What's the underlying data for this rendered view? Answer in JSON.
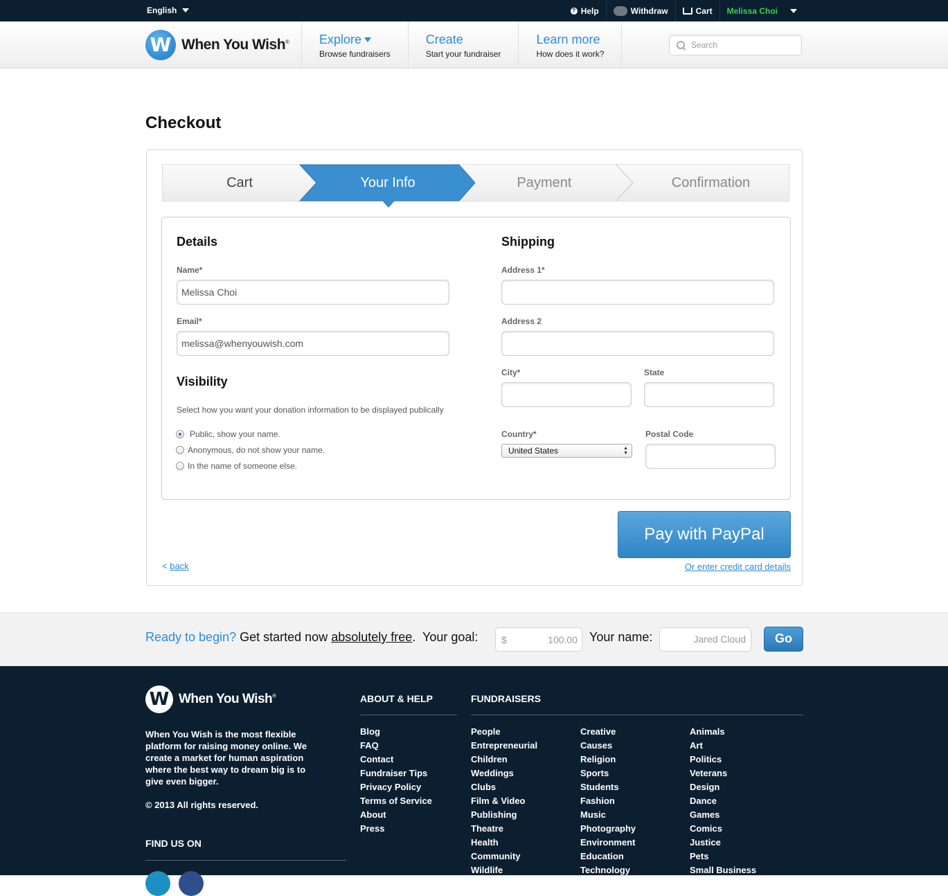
{
  "topbar": {
    "language": "English",
    "help": "Help",
    "withdraw": "Withdraw",
    "cart": "Cart",
    "user": "Melissa Choi",
    "icons": [
      "help-icon",
      "piggy-bank-icon",
      "cart-icon"
    ]
  },
  "header": {
    "logo_text": "When You Wish",
    "logo_mark": "W",
    "logo_reg": "®",
    "nav": [
      {
        "title": "Explore",
        "sub": "Browse fundraisers"
      },
      {
        "title": "Create",
        "sub": "Start your fundraiser"
      },
      {
        "title": "Learn more",
        "sub": "How does it work?"
      }
    ],
    "search_placeholder": "Search"
  },
  "page": {
    "title": "Checkout"
  },
  "steps": [
    {
      "label": "Cart",
      "state": "done"
    },
    {
      "label": "Your Info",
      "state": "active"
    },
    {
      "label": "Payment",
      "state": "pending"
    },
    {
      "label": "Confirmation",
      "state": "pending"
    }
  ],
  "details": {
    "heading": "Details",
    "name_label": "Name*",
    "name_value": "Melissa Choi",
    "email_label": "Email*",
    "email_value": "melissa@whenyouwish.com"
  },
  "visibility": {
    "heading": "Visibility",
    "description": "Select how you want your donation information to be displayed publically",
    "options": [
      {
        "label": "Public, show your name.",
        "selected": true
      },
      {
        "label": "Anonymous, do not show your name.",
        "selected": false
      },
      {
        "label": "In the name of someone else.",
        "selected": false
      }
    ]
  },
  "shipping": {
    "heading": "Shipping",
    "address1_label": "Address 1*",
    "address2_label": "Address 2",
    "city_label": "City*",
    "state_label": "State",
    "country_label": "Country*",
    "country_value": "United States",
    "postal_label": "Postal Code"
  },
  "actions": {
    "paypal": "Pay with PayPal",
    "back_prefix": "<",
    "back": "back",
    "credit_card": "Or enter credit card details"
  },
  "ready": {
    "lead": "Ready to begin?",
    "text1": "Get started now",
    "free": "absolutely free",
    "text2": ".  Your goal:",
    "currency": "$",
    "goal_value": "100.00",
    "name_label": "Your name:",
    "name_placeholder": "Jared Cloud",
    "go": "Go"
  },
  "footer": {
    "logo_text": "When You Wish",
    "logo_mark": "W",
    "logo_reg": "®",
    "about": "When You Wish is the most flexible platform for raising money online. We create a market for human aspiration where the best way to dream big is to give even bigger.",
    "copyright": "© 2013 All rights reserved.",
    "find_us": "FIND US ON",
    "about_help_heading": "ABOUT & HELP",
    "about_help_links": [
      "Blog",
      "FAQ",
      "Contact",
      "Fundraiser Tips",
      "Privacy Policy",
      "Terms of Service",
      "About",
      "Press"
    ],
    "fundraisers_heading": "FUNDRAISERS",
    "col1": [
      "People",
      "Entrepreneurial",
      "Children",
      "Weddings",
      "Clubs",
      "Film & Video",
      "Publishing",
      "Theatre",
      "Health",
      "Community",
      "Wildlife"
    ],
    "col2": [
      "Creative",
      "Causes",
      "Religion",
      "Sports",
      "Students",
      "Fashion",
      "Music",
      "Photography",
      "Environment",
      "Education",
      "Technology"
    ],
    "col3": [
      "Animals",
      "Art",
      "Politics",
      "Veterans",
      "Design",
      "Dance",
      "Games",
      "Comics",
      "Justice",
      "Pets",
      "Small Business"
    ],
    "colors": {
      "social1": "#1d8fc1",
      "social2": "#2f4f8c"
    }
  },
  "colors": {
    "brand_blue": "#2a8cd8",
    "navy": "#0c1f30",
    "user_green": "#39d24a"
  }
}
